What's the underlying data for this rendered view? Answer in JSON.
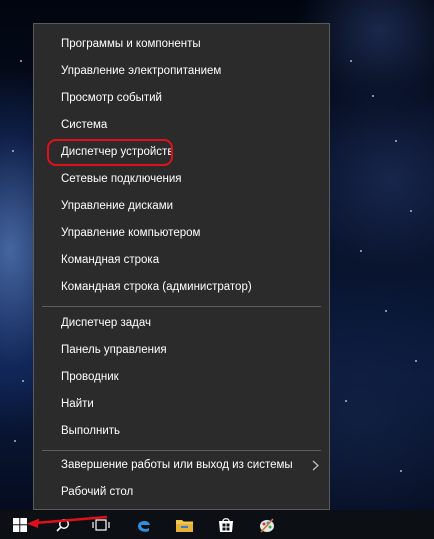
{
  "menu": {
    "items": [
      "Программы и компоненты",
      "Управление электропитанием",
      "Просмотр событий",
      "Система",
      "Диспетчер устройств",
      "Сетевые подключения",
      "Управление дисками",
      "Управление компьютером",
      "Командная строка",
      "Командная строка (администратор)",
      "Диспетчер задач",
      "Панель управления",
      "Проводник",
      "Найти",
      "Выполнить",
      "Завершение работы или выход из системы",
      "Рабочий стол"
    ],
    "highlighted_item": "Диспетчер устройств",
    "has_submenu": "Завершение работы или выход из системы"
  },
  "taskbar": {
    "icons": [
      "windows-start-icon",
      "search-icon",
      "task-view-icon",
      "edge-icon",
      "file-explorer-icon",
      "store-icon",
      "paint-icon"
    ]
  },
  "colors": {
    "menu_background": "#2b2b2b",
    "menu_text": "#ffffff",
    "highlight_ring": "#e0101a",
    "taskbar": "#0c0f14"
  }
}
